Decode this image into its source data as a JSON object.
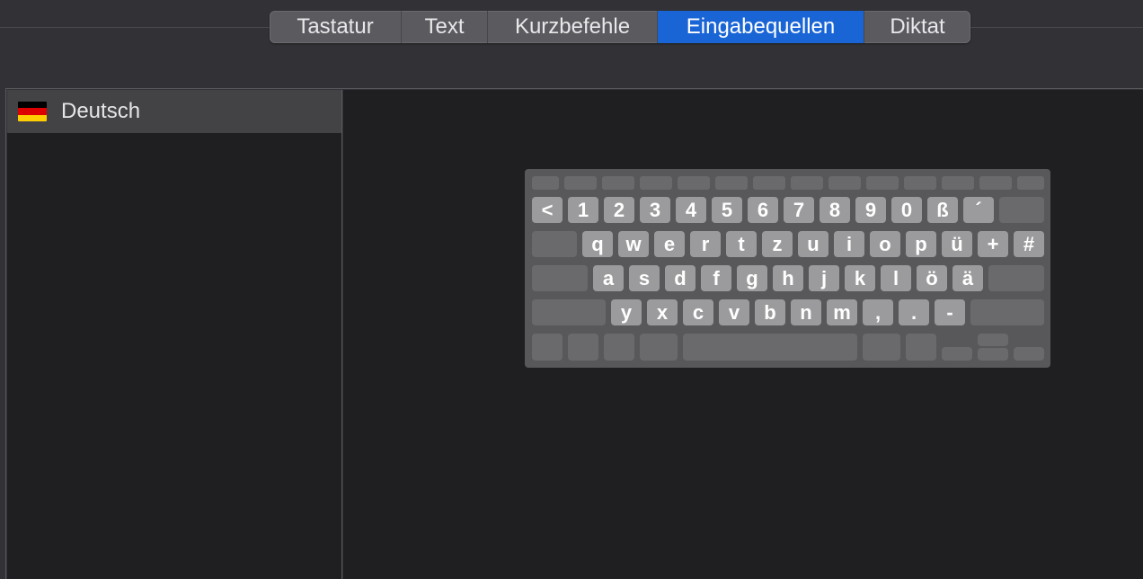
{
  "tabs": [
    {
      "label": "Tastatur",
      "active": false
    },
    {
      "label": "Text",
      "active": false
    },
    {
      "label": "Kurzbefehle",
      "active": false
    },
    {
      "label": "Eingabequellen",
      "active": true
    },
    {
      "label": "Diktat",
      "active": false
    }
  ],
  "sources": [
    {
      "label": "Deutsch",
      "flag_colors": [
        "#000000",
        "#dd0000",
        "#ffce00"
      ]
    }
  ],
  "keyboard": {
    "row1": [
      "<",
      "1",
      "2",
      "3",
      "4",
      "5",
      "6",
      "7",
      "8",
      "9",
      "0",
      "ß",
      "´"
    ],
    "row2": [
      "q",
      "w",
      "e",
      "r",
      "t",
      "z",
      "u",
      "i",
      "o",
      "p",
      "ü",
      "+",
      "#"
    ],
    "row3": [
      "a",
      "s",
      "d",
      "f",
      "g",
      "h",
      "j",
      "k",
      "l",
      "ö",
      "ä"
    ],
    "row4": [
      "y",
      "x",
      "c",
      "v",
      "b",
      "n",
      "m",
      ",",
      ".",
      "-"
    ]
  },
  "colors": {
    "accent": "#1a65d6",
    "key": "#9b9b9d",
    "key_blank": "#6a6a6d",
    "keyboard_bg": "#58585b"
  }
}
